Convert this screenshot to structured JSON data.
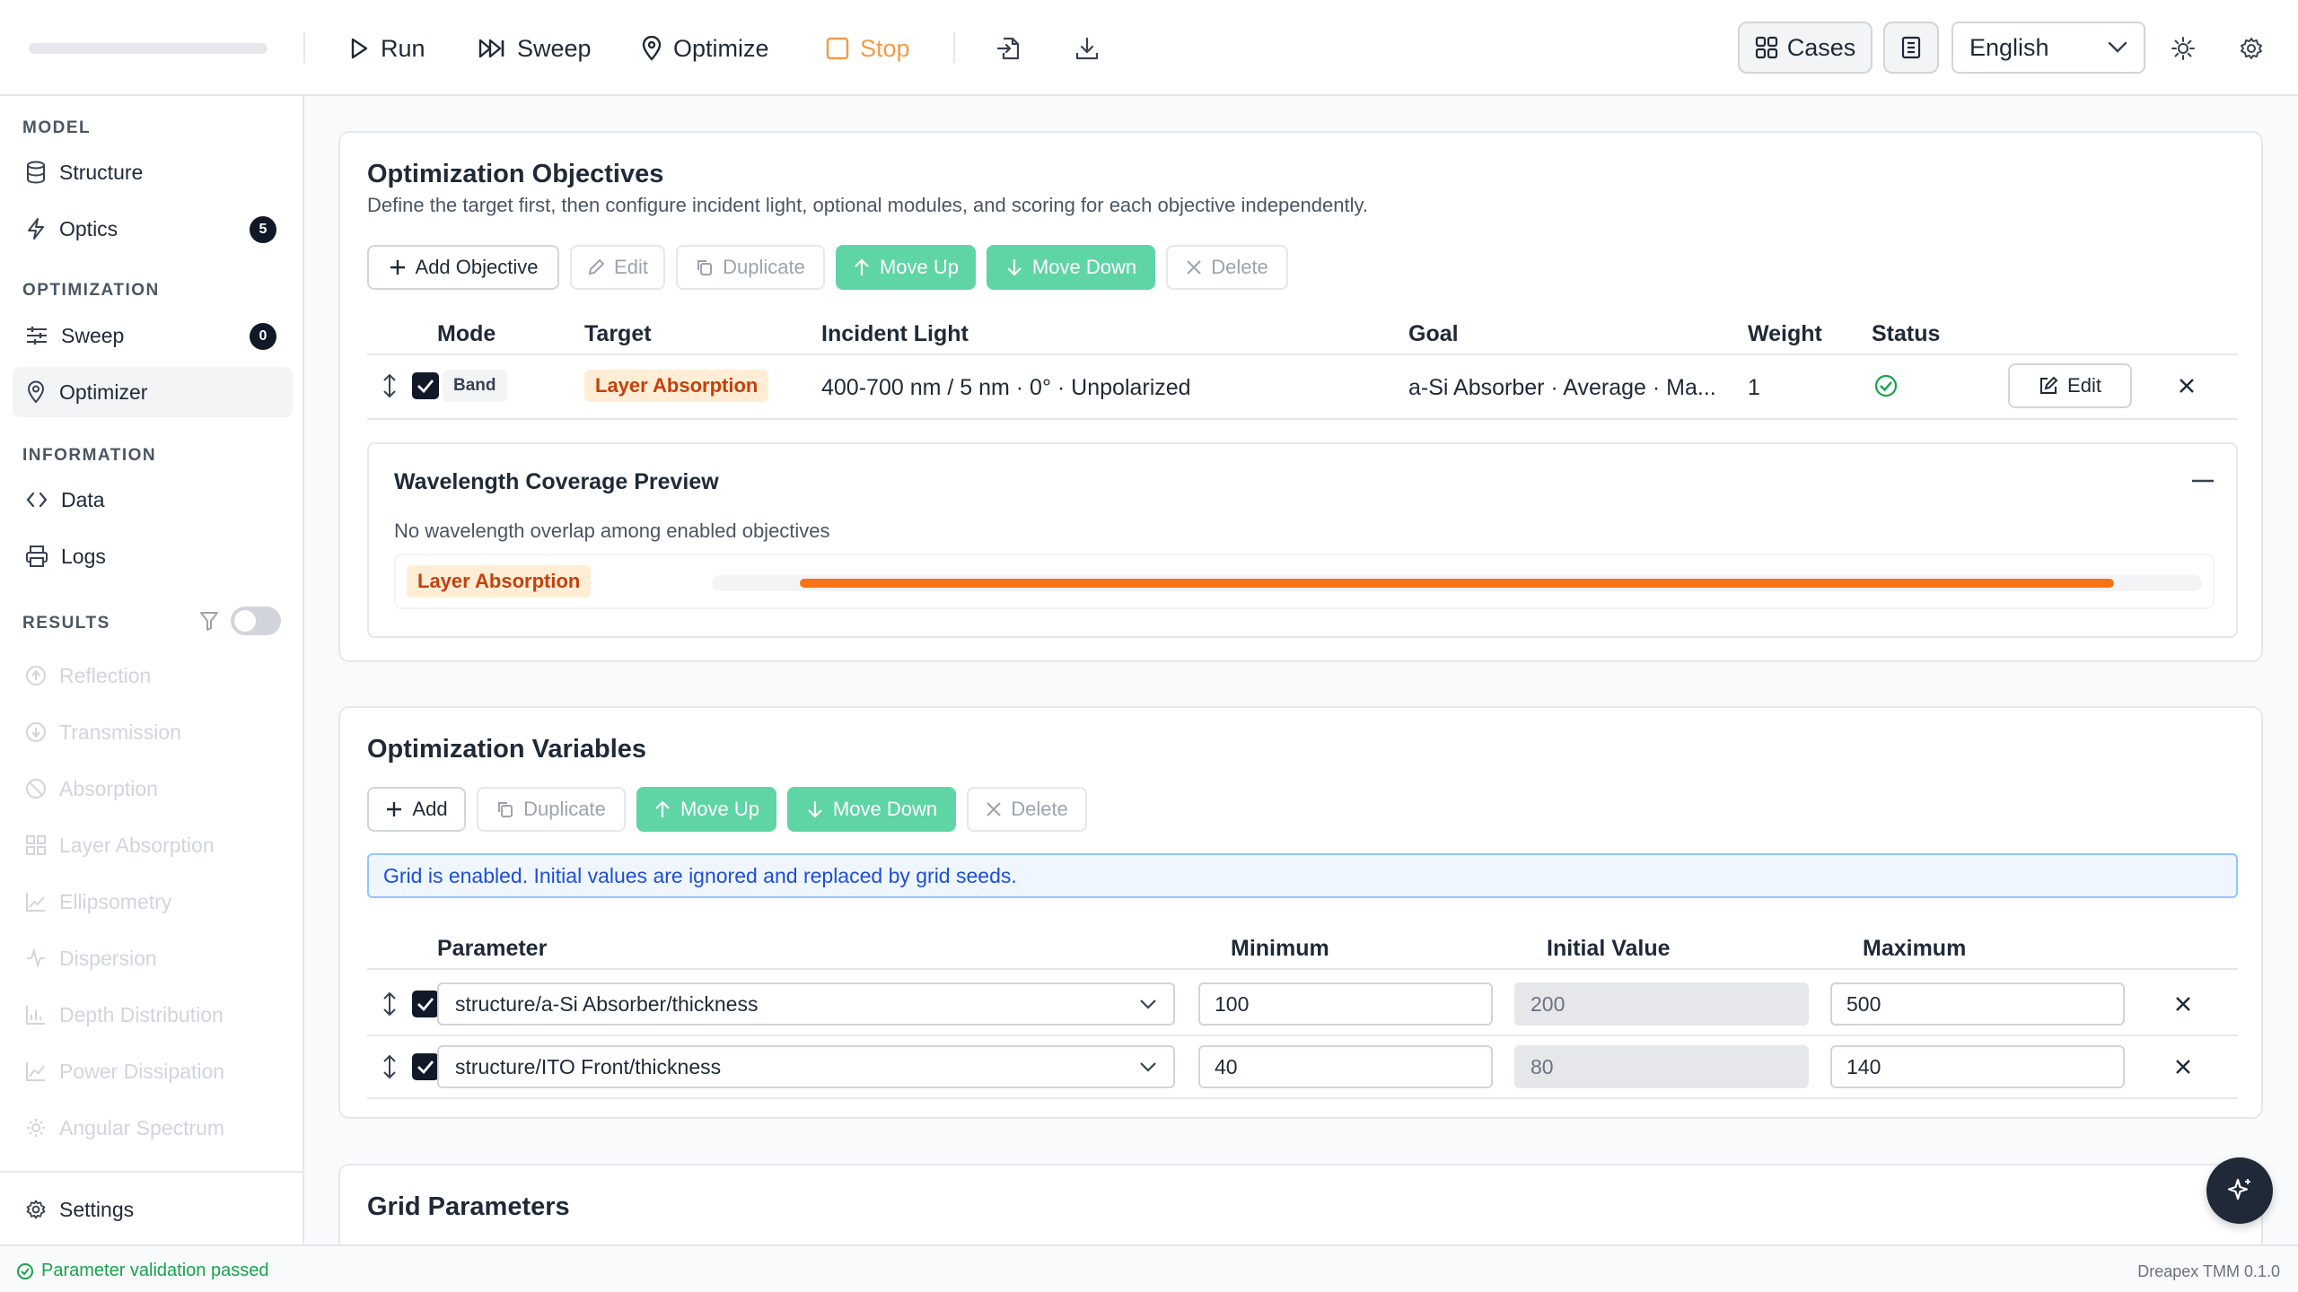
{
  "toolbar": {
    "run": "Run",
    "sweep": "Sweep",
    "optimize": "Optimize",
    "stop": "Stop",
    "cases": "Cases",
    "language": "English"
  },
  "sidebar": {
    "model_head": "MODEL",
    "structure": "Structure",
    "optics": "Optics",
    "optics_badge": "5",
    "optimization_head": "OPTIMIZATION",
    "sweep": "Sweep",
    "sweep_badge": "0",
    "optimizer": "Optimizer",
    "information_head": "INFORMATION",
    "data": "Data",
    "logs": "Logs",
    "results_head": "RESULTS",
    "results": [
      "Reflection",
      "Transmission",
      "Absorption",
      "Layer Absorption",
      "Ellipsometry",
      "Dispersion",
      "Depth Distribution",
      "Power Dissipation",
      "Angular Spectrum"
    ],
    "settings": "Settings"
  },
  "objectives": {
    "title": "Optimization Objectives",
    "description": "Define the target first, then configure incident light, optional modules, and scoring for each objective independently.",
    "buttons": {
      "add": "Add Objective",
      "edit": "Edit",
      "duplicate": "Duplicate",
      "move_up": "Move Up",
      "move_down": "Move Down",
      "delete": "Delete"
    },
    "columns": {
      "mode": "Mode",
      "target": "Target",
      "incident": "Incident Light",
      "goal": "Goal",
      "weight": "Weight",
      "status": "Status"
    },
    "rows": [
      {
        "mode": "Band",
        "target": "Layer Absorption",
        "incident": "400-700 nm / 5 nm · 0° · Unpolarized",
        "goal": "a-Si Absorber · Average · Ma...",
        "weight": "1",
        "edit": "Edit"
      }
    ],
    "coverage": {
      "title": "Wavelength Coverage Preview",
      "note": "No wavelength overlap among enabled objectives",
      "label": "Layer Absorption",
      "range_nm": [
        400,
        700
      ],
      "bar_color": "#f97316"
    }
  },
  "variables": {
    "title": "Optimization Variables",
    "buttons": {
      "add": "Add",
      "duplicate": "Duplicate",
      "move_up": "Move Up",
      "move_down": "Move Down",
      "delete": "Delete"
    },
    "info": "Grid is enabled. Initial values are ignored and replaced by grid seeds.",
    "columns": {
      "parameter": "Parameter",
      "minimum": "Minimum",
      "initial": "Initial Value",
      "maximum": "Maximum"
    },
    "rows": [
      {
        "parameter": "structure/a-Si Absorber/thickness",
        "min": "100",
        "initial": "200",
        "max": "500"
      },
      {
        "parameter": "structure/ITO Front/thickness",
        "min": "40",
        "initial": "80",
        "max": "140"
      }
    ]
  },
  "grid": {
    "title": "Grid Parameters"
  },
  "status": {
    "message": "Parameter validation passed",
    "version": "Dreapex TMM 0.1.0"
  },
  "colors": {
    "accent_green": "#5fd4a4",
    "stop_orange": "#f2994a",
    "ok_green": "#16a34a",
    "info_blue": "#1d4ed8"
  }
}
